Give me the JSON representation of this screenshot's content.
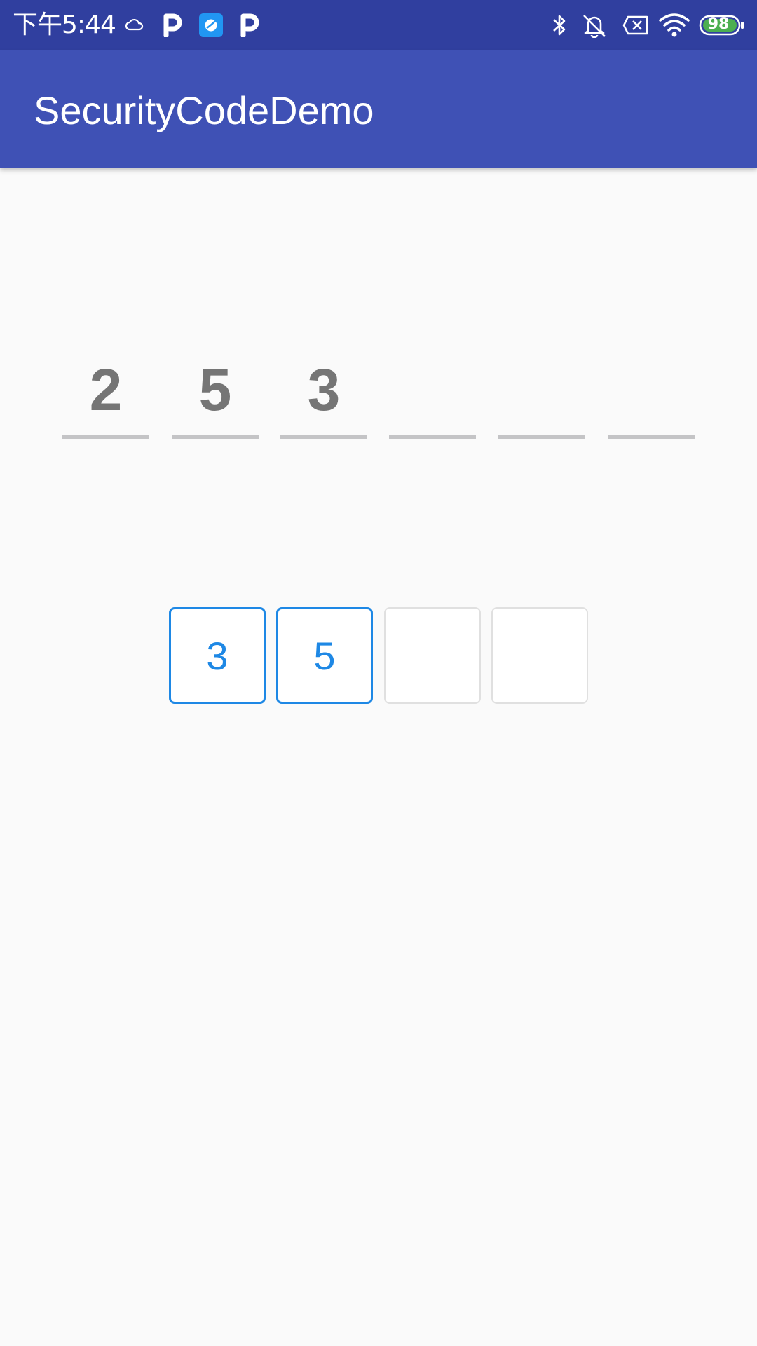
{
  "status_bar": {
    "time": "下午5:44",
    "battery_level": "98",
    "icons": [
      "cloud-icon",
      "parking-p-icon",
      "browser-app-icon",
      "parking-p-icon",
      "bluetooth-icon",
      "bell-off-icon",
      "sim-none-icon",
      "wifi-icon",
      "battery-icon"
    ],
    "colors": {
      "background": "#303f9f",
      "battery_fill": "#4caf50"
    }
  },
  "app_bar": {
    "title": "SecurityCodeDemo",
    "color": "#3f51b5"
  },
  "underline_code": {
    "length": 6,
    "digits": [
      "2",
      "5",
      "3",
      "",
      "",
      ""
    ],
    "text_color": "#757575",
    "line_color": "#c4c4c6"
  },
  "box_code": {
    "length": 4,
    "digits": [
      "3",
      "5",
      "",
      ""
    ],
    "active_color": "#1e88e5",
    "inactive_color": "#e0e0e0"
  }
}
